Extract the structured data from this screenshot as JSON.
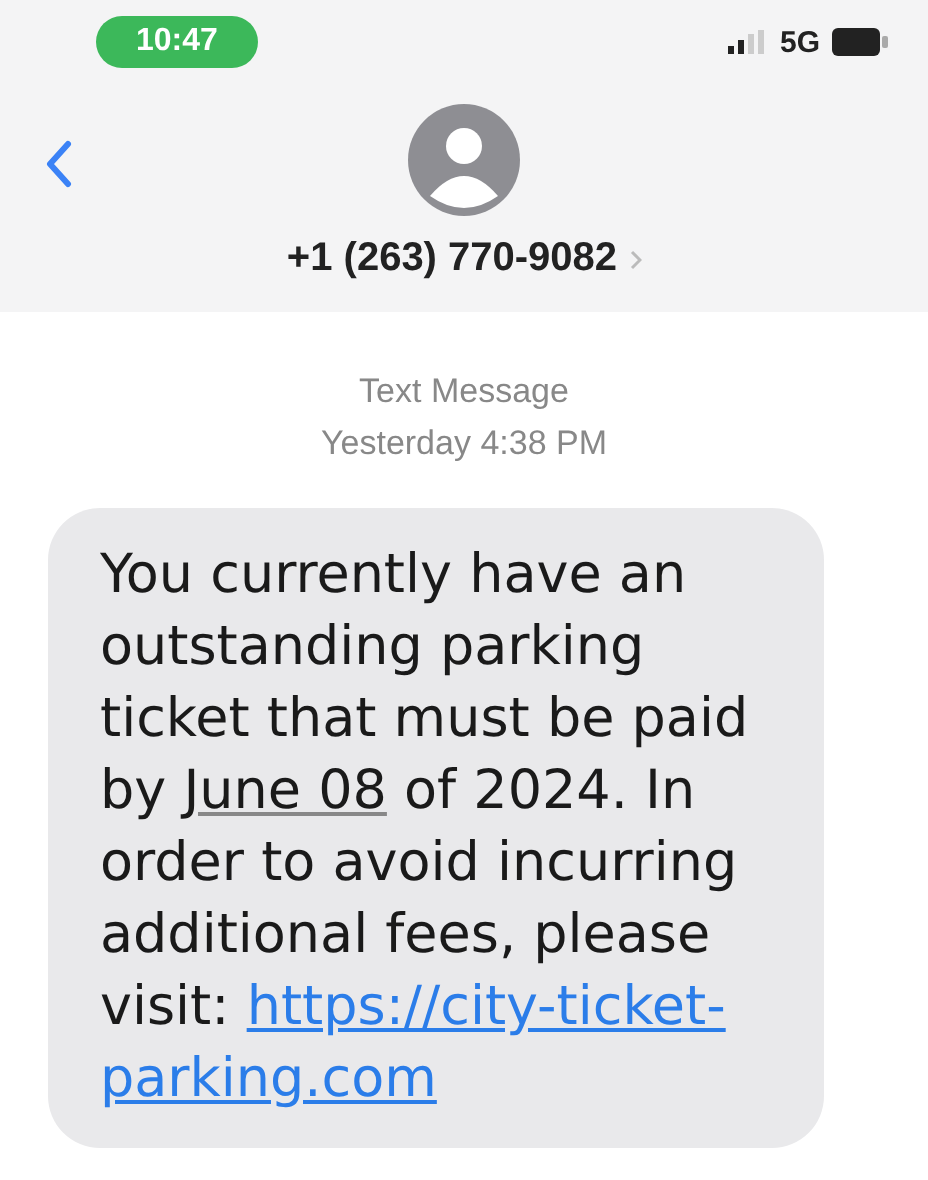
{
  "status_bar": {
    "time": "10:47",
    "network": "5G"
  },
  "header": {
    "contact": "+1 (263) 770-9082"
  },
  "conversation": {
    "service": "Text Message",
    "timestamp": "Yesterday 4:38 PM",
    "messages": [
      {
        "parts": [
          {
            "kind": "text",
            "text": "You currently have an outstanding parking ticket that must be paid by "
          },
          {
            "kind": "date",
            "text": "June 08"
          },
          {
            "kind": "text",
            "text": " of 2024. In order to avoid incurring additional fees, please visit: "
          },
          {
            "kind": "link",
            "text": "https://city-ticket-"
          },
          {
            "kind": "link",
            "text": "parking.com"
          }
        ]
      }
    ]
  }
}
